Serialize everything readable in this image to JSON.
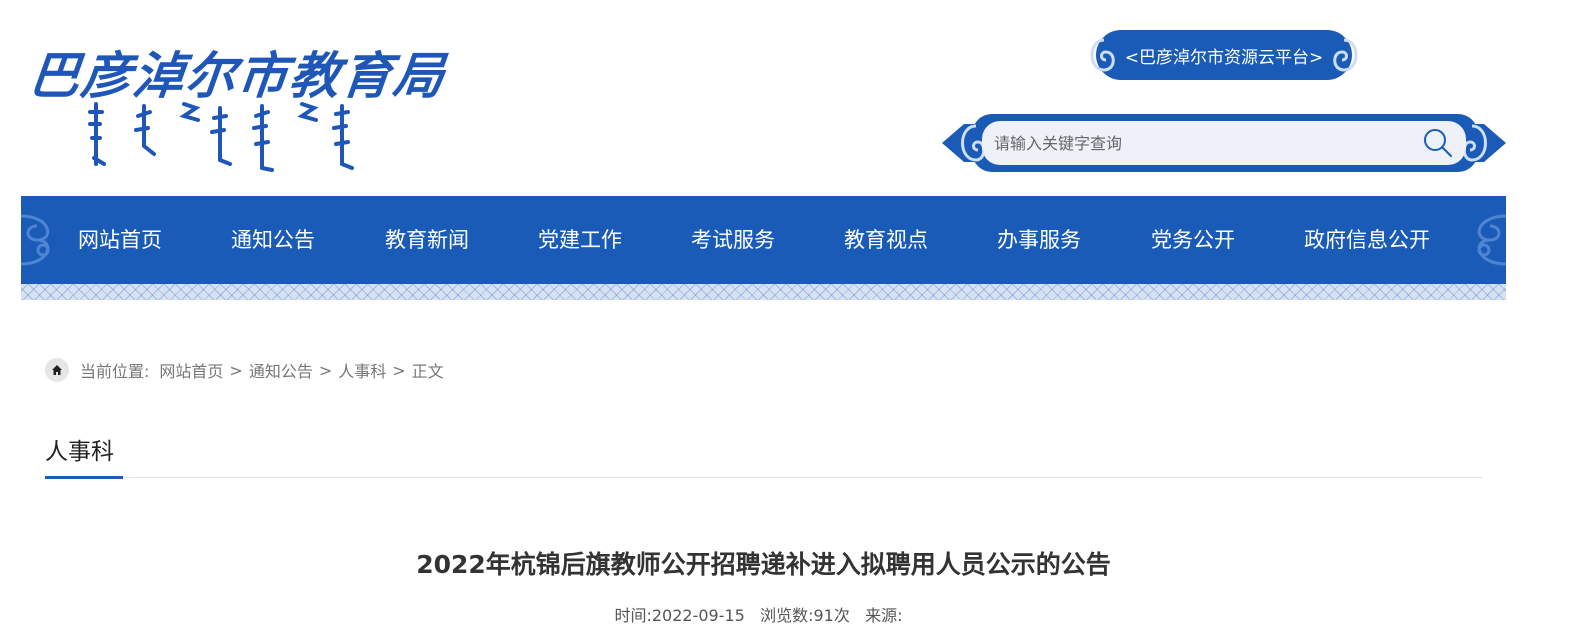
{
  "header": {
    "logo_cn": "巴彦淖尔市教育局",
    "cloud_platform_link": "<巴彦淖尔市资源云平台>",
    "search_placeholder": "请输入关键字查询"
  },
  "nav": {
    "items": [
      {
        "label": "网站首页"
      },
      {
        "label": "通知公告"
      },
      {
        "label": "教育新闻"
      },
      {
        "label": "党建工作"
      },
      {
        "label": "考试服务"
      },
      {
        "label": "教育视点"
      },
      {
        "label": "办事服务"
      },
      {
        "label": "党务公开"
      },
      {
        "label": "政府信息公开"
      }
    ]
  },
  "breadcrumb": {
    "prefix": "当前位置:",
    "items": [
      "网站首页",
      "通知公告",
      "人事科",
      "正文"
    ],
    "separator": ">"
  },
  "section": {
    "title": "人事科"
  },
  "article": {
    "title": "2022年杭锦后旗教师公开招聘递补进入拟聘用人员公示的公告",
    "meta_time_label": "时间:",
    "meta_time": "2022-09-15",
    "meta_views_label": "浏览数:",
    "meta_views": "91次",
    "meta_source_label": "来源:"
  },
  "colors": {
    "brand_blue": "#1b5bb8",
    "logo_blue": "#1f57b8",
    "search_bg": "#eef1f8"
  },
  "icons": [
    "mongolian-script-logo",
    "cloud-ornament-icon",
    "search-icon",
    "home-icon",
    "ornament-icon"
  ]
}
